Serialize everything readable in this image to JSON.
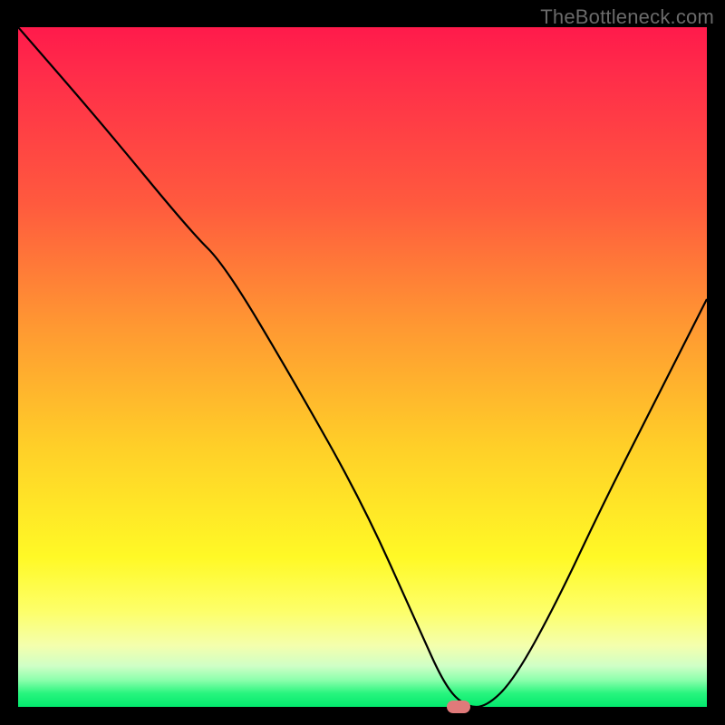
{
  "watermark": "TheBottleneck.com",
  "chart_data": {
    "type": "line",
    "title": "",
    "xlabel": "",
    "ylabel": "",
    "xlim": [
      0,
      100
    ],
    "ylim": [
      0,
      100
    ],
    "grid": false,
    "series": [
      {
        "name": "curve",
        "x": [
          0,
          12,
          25,
          30,
          40,
          50,
          58,
          62,
          65,
          68,
          72,
          78,
          85,
          92,
          100
        ],
        "values": [
          100,
          86,
          70,
          65,
          48,
          30,
          12,
          3,
          0,
          0,
          4,
          15,
          30,
          44,
          60
        ]
      }
    ],
    "marker": {
      "x_percent": 64,
      "y_percent": 0
    },
    "colors": {
      "gradient_top": "#ff1a4b",
      "gradient_mid": "#fff926",
      "gradient_bottom": "#02e96d",
      "curve": "#000000",
      "marker_fill": "#e07a7a"
    }
  }
}
